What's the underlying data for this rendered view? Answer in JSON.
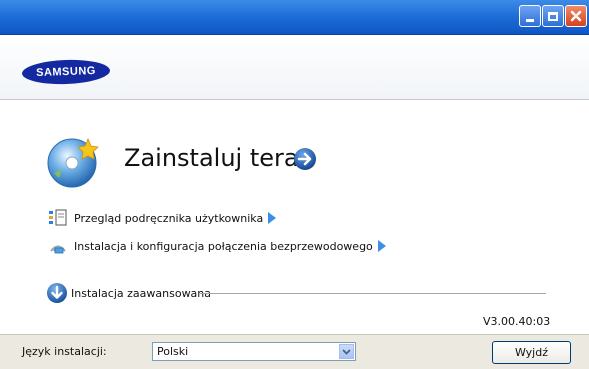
{
  "window": {
    "minimize_icon": "minimize-icon",
    "maximize_icon": "maximize-icon",
    "close_icon": "close-icon"
  },
  "header": {
    "logo_text": "SAMSUNG",
    "brand_color": "#1428a0"
  },
  "main": {
    "install_now": "Zainstaluj teraz",
    "links": [
      {
        "label": "Przegląd podręcznika użytkownika",
        "icon": "manual-book-icon"
      },
      {
        "label": "Instalacja i konfiguracja połączenia bezprzewodowego",
        "icon": "wireless-setup-icon"
      }
    ],
    "advanced": {
      "label": "Instalacja zaawansowana",
      "icon": "expand-down-icon"
    },
    "version": "V3.00.40:03",
    "accent_color": "#3d8ee5"
  },
  "footer": {
    "language_label": "Język instalacji:",
    "language_selected": "Polski",
    "exit_label": "Wyjdź"
  }
}
